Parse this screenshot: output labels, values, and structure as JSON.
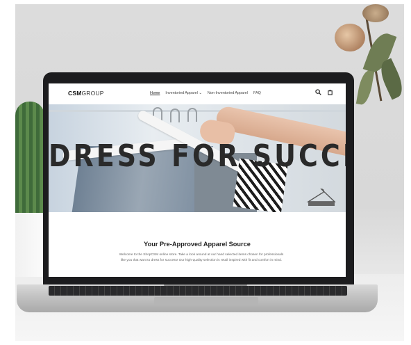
{
  "site": {
    "logo_bold": "CSM",
    "logo_light": "GROUP"
  },
  "nav": {
    "items": [
      {
        "label": "Home",
        "active": true
      },
      {
        "label": "Inventoried Apparel ⌄",
        "active": false
      },
      {
        "label": "Non-Inventoried Apparel",
        "active": false
      },
      {
        "label": "FAQ",
        "active": false
      }
    ],
    "icons": [
      "search-icon",
      "cart-icon"
    ]
  },
  "hero": {
    "title": "DRESS FOR SUCCESS"
  },
  "content": {
    "heading": "Your Pre-Approved Apparel Source",
    "body": "Welcome to the ShopCSM online store. Take a look around at our hand selected items chosen for professionals like you that want to dress for success! Our high-quality selection is retail inspired with fit and comfort in mind."
  }
}
